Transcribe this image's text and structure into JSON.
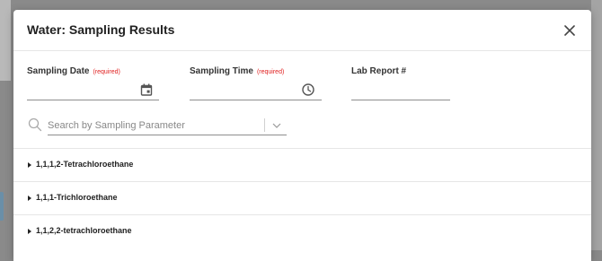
{
  "modal": {
    "title": "Water: Sampling Results"
  },
  "fields": {
    "sampling_date": {
      "label": "Sampling Date",
      "required_text": "(required)",
      "value": "",
      "icon": "calendar-icon"
    },
    "sampling_time": {
      "label": "Sampling Time",
      "required_text": "(required)",
      "value": "",
      "icon": "clock-icon"
    },
    "lab_report": {
      "label": "Lab Report #",
      "value": ""
    }
  },
  "search": {
    "placeholder": "Search by Sampling Parameter",
    "value": ""
  },
  "parameters": [
    {
      "label": "1,1,1,2-Tetrachloroethane"
    },
    {
      "label": "1,1,1-Trichloroethane"
    },
    {
      "label": "1,1,2,2-tetrachloroethane"
    }
  ],
  "colors": {
    "required": "#e02020",
    "text": "#222222",
    "divider": "#e6e6e6"
  }
}
